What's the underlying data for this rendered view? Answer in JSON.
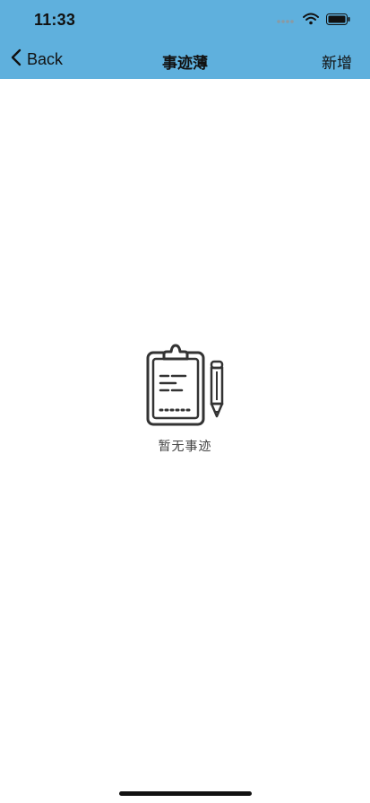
{
  "status_bar": {
    "time": "11:33",
    "icons": [
      "signal-dots-icon",
      "wifi-icon",
      "battery-icon"
    ]
  },
  "nav": {
    "back_label": "Back",
    "title": "事迹薄",
    "add_label": "新增"
  },
  "empty_state": {
    "icon": "clipboard-pencil-icon",
    "text": "暂无事迹"
  },
  "colors": {
    "header_bg": "#5fb0dd",
    "text": "#111111",
    "empty_text": "#444444",
    "icon_stroke": "#333333"
  }
}
